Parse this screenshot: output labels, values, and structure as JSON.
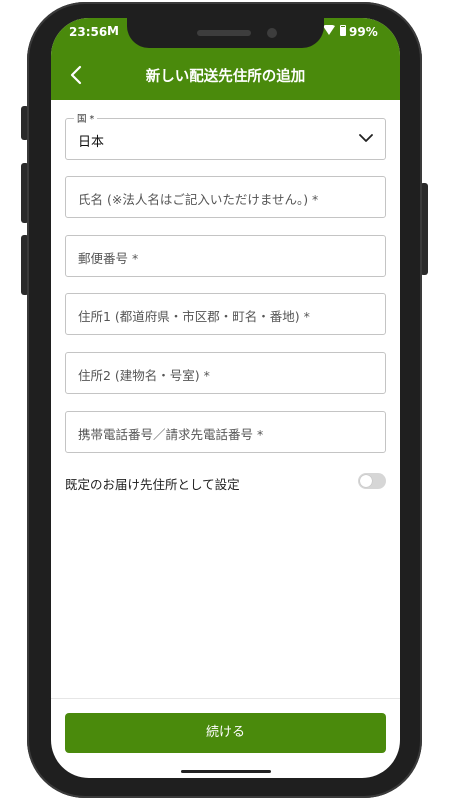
{
  "status": {
    "time": "23:56",
    "mail_glyph": "M",
    "battery": "99%"
  },
  "header": {
    "title": "新しい配送先住所の追加",
    "back_icon": "chevron-left-icon"
  },
  "form": {
    "country_label": "国 *",
    "country_value": "日本",
    "name_placeholder": "氏名 (※法人名はご記入いただけません。) *",
    "postal_placeholder": "郵便番号 *",
    "address1_placeholder": "住所1 (都道府県・市区郡・町名・番地) *",
    "address2_placeholder": "住所2 (建物名・号室) *",
    "phone_placeholder": "携帯電話番号／請求先電話番号 *",
    "default_label": "既定のお届け先住所として設定",
    "default_enabled": false
  },
  "actions": {
    "continue_label": "続ける"
  },
  "colors": {
    "brand_green": "#4a8a0c",
    "toggle_off": "#d6d6d6"
  }
}
